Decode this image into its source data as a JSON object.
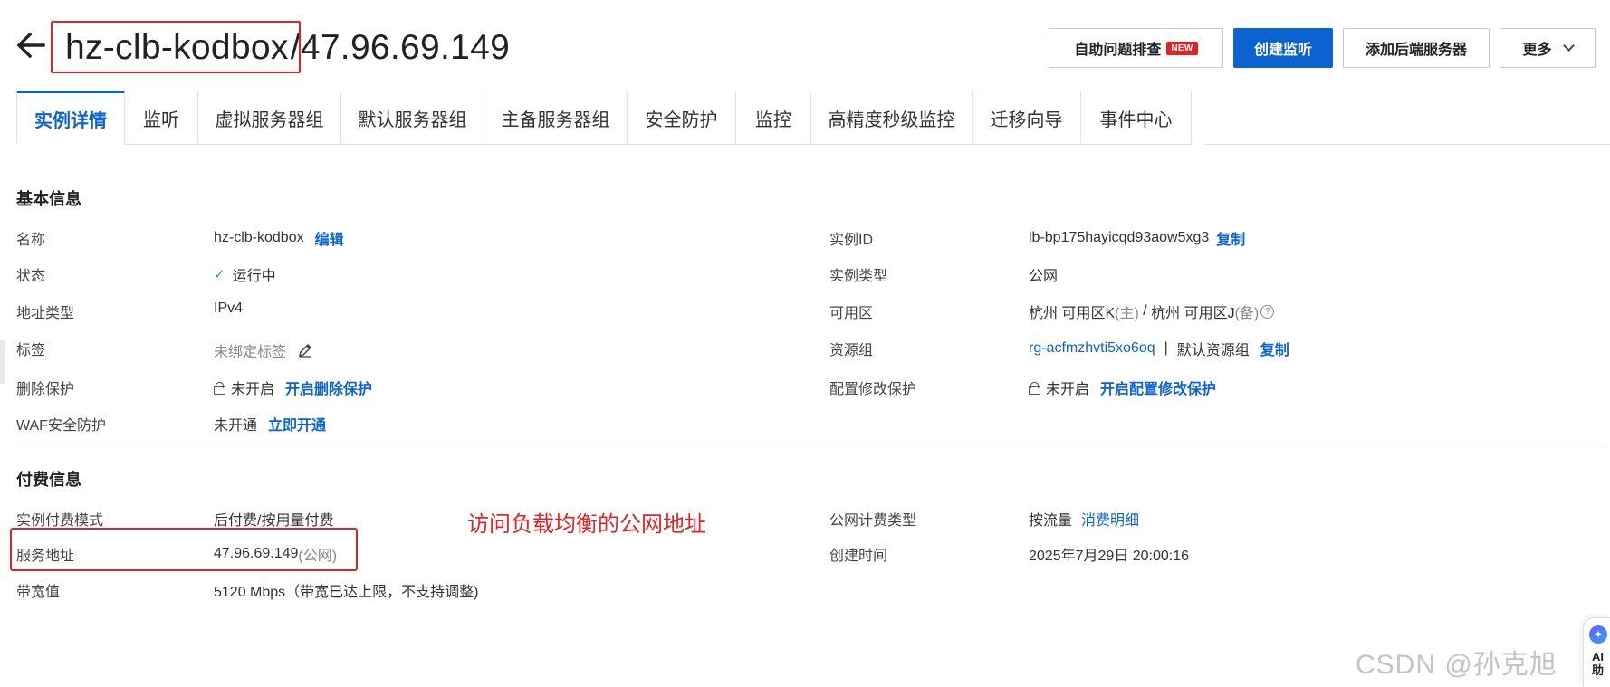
{
  "header": {
    "title_name": "hz-clb-kodbox",
    "title_suffix": "/47.96.69.149",
    "buttons": {
      "self_help": "自助问题排查",
      "new_badge": "NEW",
      "create_listener": "创建监听",
      "add_backend": "添加后端服务器",
      "more": "更多"
    }
  },
  "tabs": [
    {
      "label": "实例详情"
    },
    {
      "label": "监听"
    },
    {
      "label": "虚拟服务器组"
    },
    {
      "label": "默认服务器组"
    },
    {
      "label": "主备服务器组"
    },
    {
      "label": "安全防护"
    },
    {
      "label": "监控"
    },
    {
      "label": "高精度秒级监控"
    },
    {
      "label": "迁移向导"
    },
    {
      "label": "事件中心"
    }
  ],
  "basic_info": {
    "title": "基本信息",
    "left": {
      "name_label": "名称",
      "name_value": "hz-clb-kodbox",
      "name_edit": "编辑",
      "status_label": "状态",
      "status_value": "运行中",
      "addr_type_label": "地址类型",
      "addr_type_value": "IPv4",
      "tag_label": "标签",
      "tag_value": "未绑定标签",
      "delete_protect_label": "删除保护",
      "delete_protect_value": "未开启",
      "delete_protect_link": "开启删除保护",
      "waf_label": "WAF安全防护",
      "waf_value": "未开通",
      "waf_link": "立即开通"
    },
    "right": {
      "instance_id_label": "实例ID",
      "instance_id_value": "lb-bp175hayicqd93aow5xg3",
      "instance_id_copy": "复制",
      "instance_type_label": "实例类型",
      "instance_type_value": "公网",
      "zone_label": "可用区",
      "zone_value": "杭州 可用区K",
      "zone_primary": "(主)",
      "zone_sep": " / ",
      "zone_value2": "杭州 可用区J",
      "zone_backup": "(备)",
      "resource_group_label": "资源组",
      "resource_group_id": "rg-acfmzhvti5xo6oq",
      "resource_group_sep": "|",
      "resource_group_name": "默认资源组",
      "resource_group_copy": "复制",
      "config_protect_label": "配置修改保护",
      "config_protect_value": "未开启",
      "config_protect_link": "开启配置修改保护"
    }
  },
  "billing_info": {
    "title": "付费信息",
    "left": {
      "billing_mode_label": "实例付费模式",
      "billing_mode_value": "后付费/按用量付费",
      "service_addr_label": "服务地址",
      "service_addr_value": "47.96.69.149",
      "service_addr_type": "(公网)",
      "bandwidth_label": "带宽值",
      "bandwidth_value": "5120 Mbps（带宽已达上限，不支持调整)"
    },
    "right": {
      "public_billing_label": "公网计费类型",
      "public_billing_value": "按流量",
      "public_billing_link": "消费明细",
      "created_label": "创建时间",
      "created_value": "2025年7月29日 20:00:16"
    }
  },
  "annotation": "访问负载均衡的公网地址",
  "watermark": "CSDN @孙克旭",
  "ai_widget": {
    "label_line1": "AI",
    "label_line2": "助"
  },
  "colors": {
    "accent": "#0b63d1",
    "annotation_red": "#e02424",
    "success": "#2aa84a"
  }
}
